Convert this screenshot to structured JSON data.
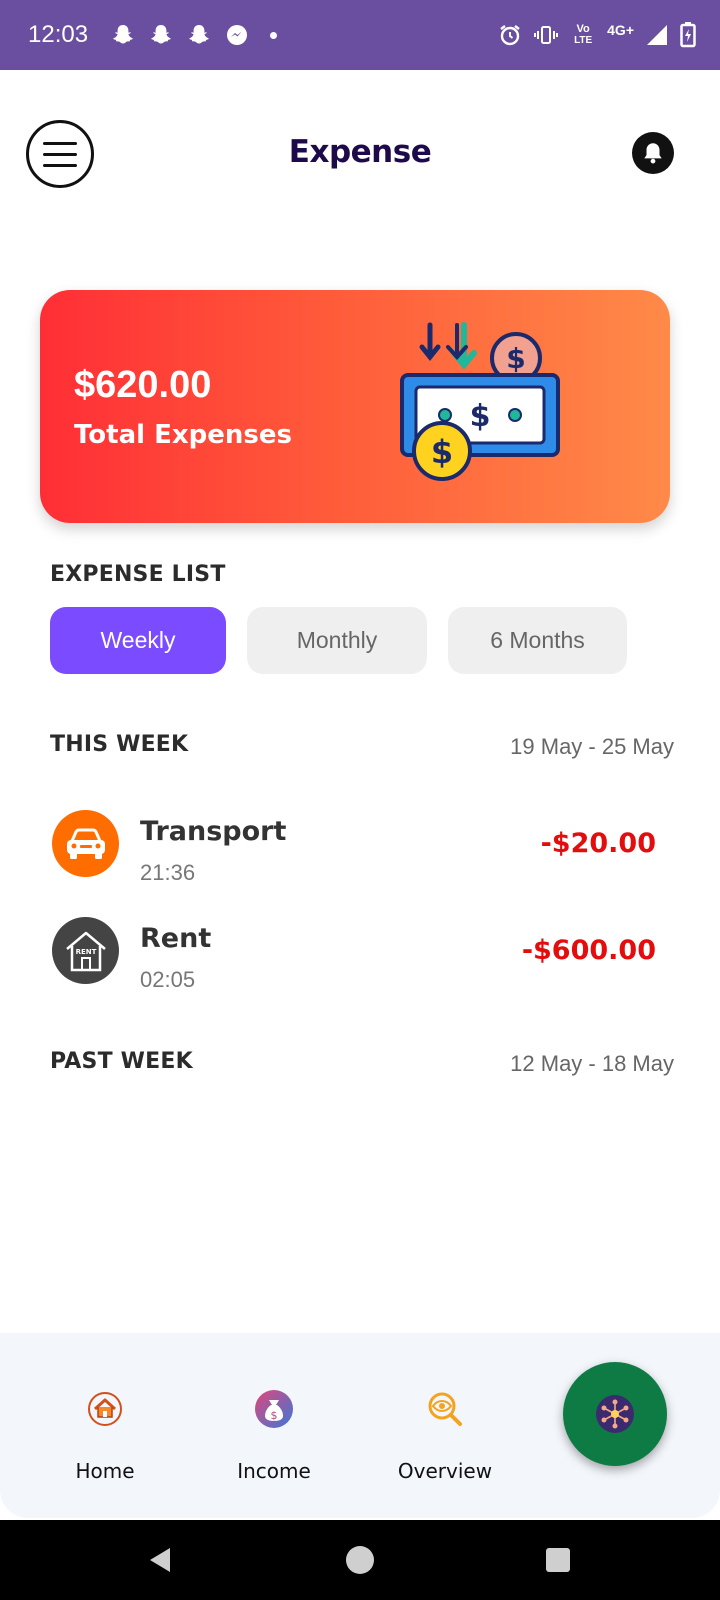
{
  "status_bar": {
    "time": "12:03",
    "left_icons": [
      "snapchat-icon",
      "snapchat-icon",
      "snapchat-icon",
      "messenger-icon"
    ],
    "right_icons": [
      "alarm-icon",
      "vibrate-icon",
      "volte-icon",
      "signal-icon",
      "battery-icon"
    ],
    "volte_text_top": "Vo",
    "volte_text_bottom": "LTE",
    "network": "4G+"
  },
  "header": {
    "title": "Expense",
    "menu_icon": "hamburger-menu-icon",
    "notification_icon": "bell-icon"
  },
  "summary": {
    "total_amount": "$620.00",
    "total_label": "Total Expenses",
    "illustration": "money-bill-icon"
  },
  "expense_list": {
    "heading": "EXPENSE LIST",
    "tabs": [
      {
        "label": "Weekly",
        "active": true
      },
      {
        "label": "Monthly",
        "active": false
      },
      {
        "label": "6 Months",
        "active": false
      }
    ]
  },
  "this_week": {
    "heading": "THIS WEEK",
    "date_range": "19 May - 25 May",
    "items": [
      {
        "title": "Transport",
        "time": "21:36",
        "amount": "-$20.00",
        "icon": "car-icon",
        "icon_color": "#ff6d00"
      },
      {
        "title": "Rent",
        "time": "02:05",
        "amount": "-$600.00",
        "icon": "rent-house-icon",
        "icon_color": "#444444",
        "icon_text": "RENT"
      }
    ]
  },
  "past_week": {
    "heading": "PAST WEEK",
    "date_range": "12 May - 18 May"
  },
  "bottom_nav": {
    "items": [
      {
        "label": "Home",
        "icon": "home-icon"
      },
      {
        "label": "Income",
        "icon": "money-bag-icon"
      },
      {
        "label": "Overview",
        "icon": "overview-search-icon"
      }
    ],
    "fab_icon": "network-hub-icon"
  },
  "colors": {
    "status_bar": "#6a4fa0",
    "accent": "#7b4cff",
    "expense_red": "#e30d0d",
    "card_gradient_start": "#ff2e36",
    "card_gradient_end": "#ff8a48",
    "fab": "#0e7b44"
  }
}
